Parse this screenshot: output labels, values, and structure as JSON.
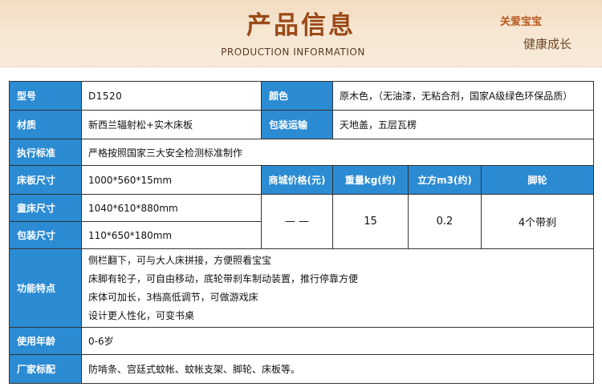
{
  "header": {
    "title": "产品信息",
    "subtitle": "PRODUCTION INFORMATION",
    "tag_primary": "关爱宝宝",
    "tag_secondary": "健康成长"
  },
  "spec": {
    "model_label": "型号",
    "model_value": "D1520",
    "color_label": "颜色",
    "color_value": "原木色，（无油漆，无粘合剂，国家A级绿色环保品质）",
    "material_label": "材质",
    "material_value": "新西兰辐射松+实木床板",
    "packaging_label": "包装运输",
    "packaging_value": "天地盖，五层瓦楞",
    "standard_label": "执行标准",
    "standard_value": "严格按照国家三大安全检测标准制作",
    "board_size_label": "床板尺寸",
    "board_size_value": "1000*560*15mm",
    "crib_size_label": "童床尺寸",
    "crib_size_value": "1040*610*880mm",
    "package_size_label": "包装尺寸",
    "package_size_value": "110*650*180mm",
    "price_label": "商城价格(元)",
    "price_value": "— —",
    "weight_label": "重量kg(约)",
    "weight_value": "15",
    "volume_label": "立方m3(约)",
    "volume_value": "0.2",
    "caster_label": "脚轮",
    "caster_value": "4个带刹",
    "features_label": "功能特点",
    "features": [
      "侧栏翻下，可与大人床拼接，方便照看宝宝",
      "床脚有轮子，可自由移动，底轮带刹车制动装置，推行停靠方便",
      "床体可加长，3档高低调节，可做游戏床",
      "设计更人性化，可变书桌"
    ],
    "age_label": "使用年龄",
    "age_value": "0-6岁",
    "accessories_label": "厂家标配",
    "accessories_value": "防啃条、宫廷式蚊帐、蚊帐支架、脚轮、床板等。"
  }
}
